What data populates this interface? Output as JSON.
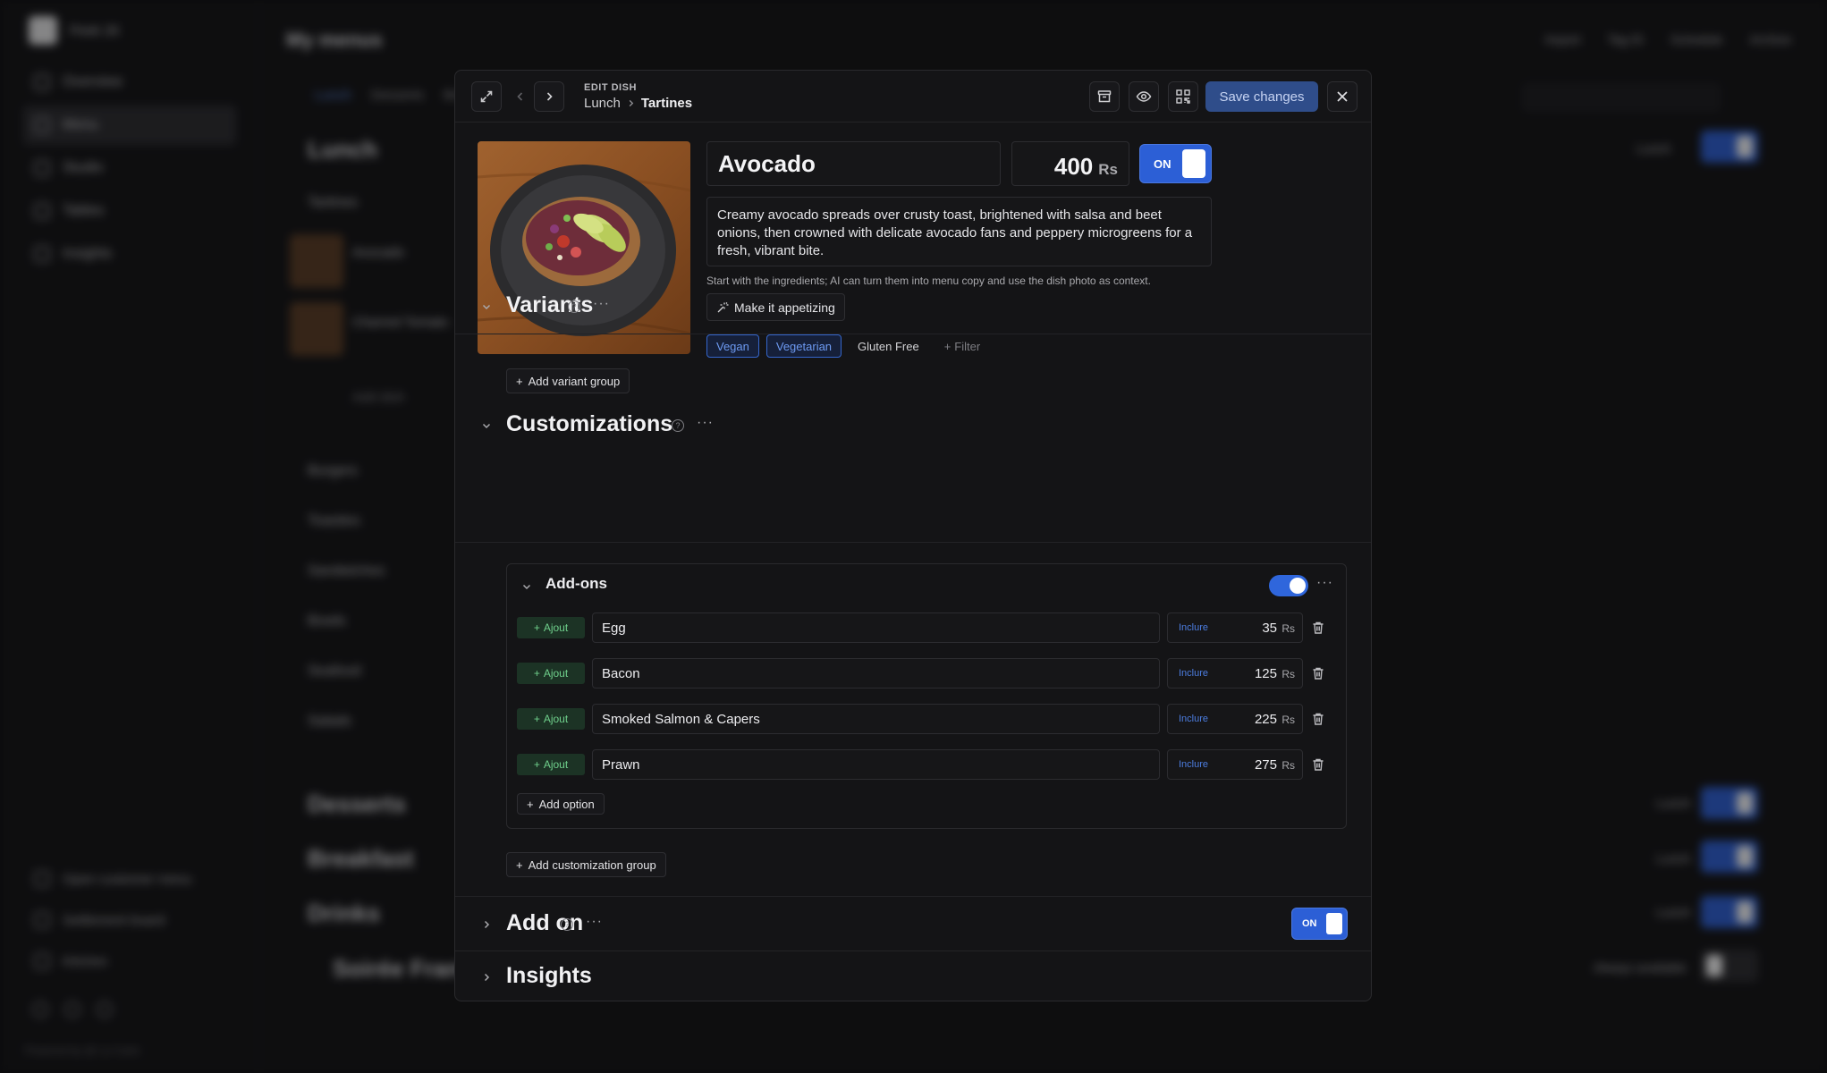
{
  "background": {
    "workspace": "Peek 26",
    "nav": [
      "Overview",
      "Menu",
      "Studio",
      "Tables",
      "Insights"
    ],
    "footer_links": [
      "Open customer menu",
      "Settlement board",
      "Kitchen"
    ],
    "powered_by": "Powered by @ La Carte",
    "page_title": "My menus",
    "header_actions": [
      "Import",
      "Tag ID",
      "Schedule",
      "Archive"
    ],
    "tabs": [
      "Lunch",
      "Desserts",
      "Breakfast"
    ],
    "search_placeholder": "plat, catégorie, etc.",
    "sections": [
      "Lunch",
      "Desserts",
      "Breakfast",
      "Drinks",
      "Soirée Française"
    ],
    "subcategories": [
      "Tartines",
      "Burgers",
      "Toasties",
      "Sandwiches",
      "Bowls",
      "Seafood",
      "Salads"
    ],
    "dishes": [
      "Avocado",
      "Charred Tomato"
    ],
    "add_dish": "Add dish",
    "menu_label": "Lunch",
    "always_available": "Always available"
  },
  "modal": {
    "kicker": "EDIT DISH",
    "breadcrumb": [
      "Lunch",
      "Tartines"
    ],
    "save_label": "Save changes",
    "dish": {
      "name": "Avocado",
      "price": "400",
      "currency": "Rs",
      "available_label": "ON",
      "description": "Creamy avocado spreads over crusty toast, brightened with salsa and beet onions, then crowned with delicate avocado fans and peppery microgreens for a fresh, vibrant bite.",
      "hint": "Start with the ingredients; AI can turn them into menu copy and use the dish photo as context.",
      "ai_button": "Make it appetizing",
      "tags": [
        {
          "label": "Vegan",
          "selected": true
        },
        {
          "label": "Vegetarian",
          "selected": true
        },
        {
          "label": "Gluten Free",
          "selected": false
        }
      ],
      "filter_label": "Filter"
    },
    "variants": {
      "title": "Variants",
      "add_label": "Add variant group"
    },
    "customizations": {
      "title": "Customizations",
      "group": {
        "title": "Add-ons",
        "enabled": true,
        "options": [
          {
            "badge": "Ajout",
            "name": "Egg",
            "included": "Inclure",
            "price": "35",
            "currency": "Rs"
          },
          {
            "badge": "Ajout",
            "name": "Bacon",
            "included": "Inclure",
            "price": "125",
            "currency": "Rs"
          },
          {
            "badge": "Ajout",
            "name": "Smoked Salmon & Capers",
            "included": "Inclure",
            "price": "225",
            "currency": "Rs"
          },
          {
            "badge": "Ajout",
            "name": "Prawn",
            "included": "Inclure",
            "price": "275",
            "currency": "Rs"
          }
        ],
        "add_option_label": "Add option"
      },
      "add_group_label": "Add customization group"
    },
    "addon": {
      "title": "Add on",
      "toggle_label": "ON"
    },
    "insights": {
      "title": "Insights"
    }
  },
  "colors": {
    "accent": "#2c5fd6",
    "save_button": "#2f4d8a",
    "ajout_green": "#6fd08c",
    "tag_blue": "#3566cc"
  }
}
